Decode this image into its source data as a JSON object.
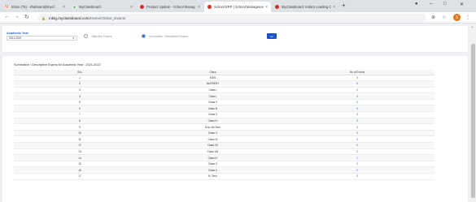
{
  "browser": {
    "tabs": [
      {
        "title": "Inbox (78) - shabnam@mycl",
        "favicon": "M",
        "color": "#ea4335",
        "active": false
      },
      {
        "title": "MyClassboard",
        "favicon": "◈",
        "color": "#34a853",
        "active": false
      },
      {
        "title": "Product Update - School Manag",
        "favicon": "●",
        "color": "#d93025",
        "active": false
      },
      {
        "title": "School ERP | School Manageme",
        "favicon": "●",
        "color": "#d93025",
        "active": true
      },
      {
        "title": "MyClassboard: India's Leading C",
        "favicon": "●",
        "color": "#d93025",
        "active": false
      }
    ],
    "new_tab": "+",
    "url_host": "mktg.myclassboard.com",
    "url_path": "/Home/Online_Exams",
    "avatar_letter": "S"
  },
  "filters": {
    "academic_year_label": "Academic Year",
    "academic_year_value": "2021-2022",
    "radio_objective": "Objective Exams",
    "radio_summative": "Summative / Descriptive Exams",
    "go_button": "Go"
  },
  "table": {
    "title": "Summative / Descriptive Exams for Academic Year : 2021-2022",
    "headers": [
      "Sno",
      "Class",
      "No of Exams"
    ],
    "rows": [
      {
        "sno": "1",
        "class": "KIDS",
        "exams": "0"
      },
      {
        "sno": "2",
        "class": "NURSERY",
        "exams": "0"
      },
      {
        "sno": "3",
        "class": "Class I",
        "exams": "0"
      },
      {
        "sno": "4",
        "class": "Class I",
        "exams": "0"
      },
      {
        "sno": "5",
        "class": "Class II",
        "exams": "0"
      },
      {
        "sno": "6",
        "class": "Class III",
        "exams": "0"
      },
      {
        "sno": "7",
        "class": "Class II",
        "exams": "0"
      },
      {
        "sno": "8",
        "class": "Class IV",
        "exams": "0"
      },
      {
        "sno": "9",
        "class": "B.sc 4th Sem",
        "exams": "0"
      },
      {
        "sno": "10",
        "class": "Class V",
        "exams": "0"
      },
      {
        "sno": "11",
        "class": "Class VI",
        "exams": "0"
      },
      {
        "sno": "12",
        "class": "Class VII",
        "exams": "0"
      },
      {
        "sno": "13",
        "class": "Class VIII",
        "exams": "2"
      },
      {
        "sno": "14",
        "class": "Class IX",
        "exams": "1"
      },
      {
        "sno": "15",
        "class": "Class X",
        "exams": "0"
      },
      {
        "sno": "16",
        "class": "Class X",
        "exams": "0"
      },
      {
        "sno": "17",
        "class": "B. Tech",
        "exams": "0"
      }
    ]
  }
}
